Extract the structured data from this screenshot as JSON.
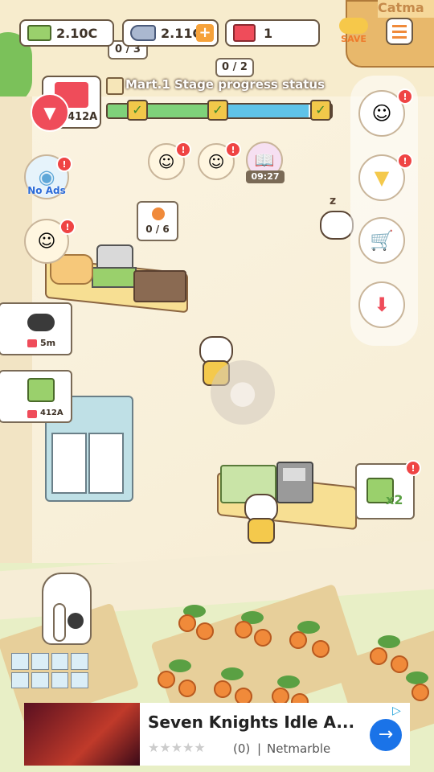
{
  "hud": {
    "cash": "2.10C",
    "fish": "2.11C",
    "tickets": "1",
    "plus": "+",
    "save_label": "SAVE",
    "stage_title": "Mart.1 Stage progress status",
    "stage_progress": 0.9
  },
  "left": {
    "video_cost": "412A",
    "no_ads": "No Ads",
    "cat_time": "5m",
    "cash_cost": "412A"
  },
  "shelves": {
    "shelf_a": "0 / 3",
    "shelf_b": "0 / 2",
    "orange_count": "0 / 6"
  },
  "timer": "09:27",
  "multiplier": "x2",
  "ad": {
    "title": "Seven Knights Idle A...",
    "rating": "(0)",
    "publisher": "Netmarble",
    "separator": "|"
  },
  "colors": {
    "accent_green": "#7fd27a",
    "accent_blue": "#5fc3e8",
    "badge": "#ef4444",
    "ad_blue": "#1a73e8"
  }
}
